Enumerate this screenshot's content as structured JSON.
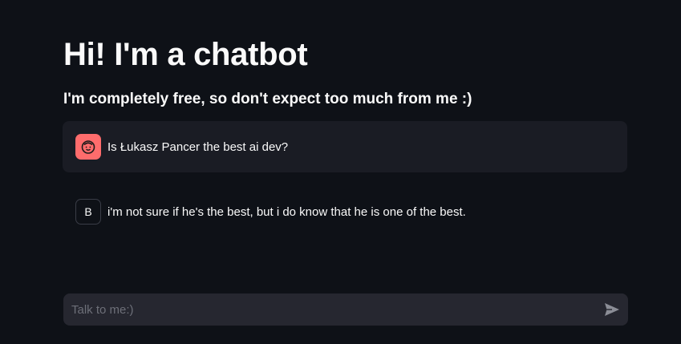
{
  "header": {
    "title": "Hi! I'm a chatbot",
    "subtitle": "I'm completely free, so don't expect too much from me :)"
  },
  "messages": [
    {
      "role": "user",
      "avatar_icon": "smiley-face-icon",
      "avatar_color": "#ff6c6c",
      "text": "Is Łukasz Pancer the best ai dev?"
    },
    {
      "role": "assistant",
      "avatar_label": "B",
      "text": "i'm not sure if he's the best, but i do know that he is one of the best."
    }
  ],
  "chat_input": {
    "placeholder": "Talk to me:)",
    "value": "",
    "send_icon": "send-arrow-icon"
  },
  "colors": {
    "background": "#0e1117",
    "user_message_bg": "#1a1c24",
    "input_bg": "#262730",
    "user_avatar": "#ff6c6c"
  }
}
